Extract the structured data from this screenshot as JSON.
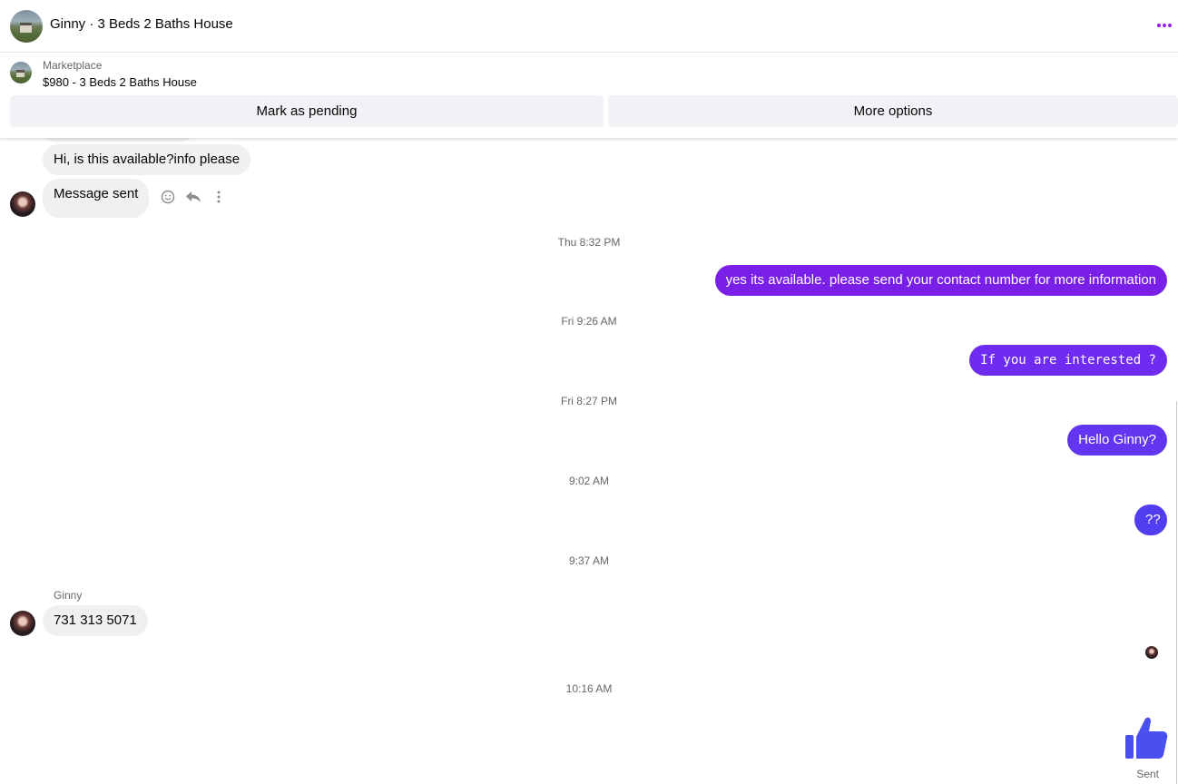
{
  "header": {
    "title": "Ginny · 3 Beds 2 Baths House",
    "avatar_icon": "house-photo",
    "more_icon": "more-dots-icon",
    "accent": "#9b1fe8"
  },
  "marketplace": {
    "label": "Marketplace",
    "item": "$980 - 3 Beds 2 Baths House",
    "buttons": {
      "pending": "Mark as pending",
      "options": "More options"
    }
  },
  "messages": {
    "incoming_1": "Hi, is this available?info please",
    "incoming_2": "Message sent",
    "tools": [
      "emoji-icon",
      "reply-icon",
      "more-vertical-icon"
    ],
    "time_1": "Thu 8:32 PM",
    "outgoing_1": "yes its available. please send your contact number for more information",
    "time_2": "Fri 9:26 AM",
    "outgoing_2": "If you are interested ?",
    "time_3": "Fri 8:27 PM",
    "outgoing_3": "Hello Ginny?",
    "time_4": "9:02 AM",
    "outgoing_4": "??",
    "time_5": "9:37 AM",
    "sender_name": "Ginny",
    "incoming_3": "731 313 5071",
    "time_6": "10:16 AM",
    "like_icon": "thumbs-up-icon",
    "status": "Sent"
  },
  "colors": {
    "outgoing_1": "#7a1fe8",
    "outgoing_2": "#6f2bf0",
    "outgoing_3": "#6236f0",
    "outgoing_4": "#533df0",
    "like": "#4a4ff0",
    "incoming": "#f0f0f0"
  }
}
